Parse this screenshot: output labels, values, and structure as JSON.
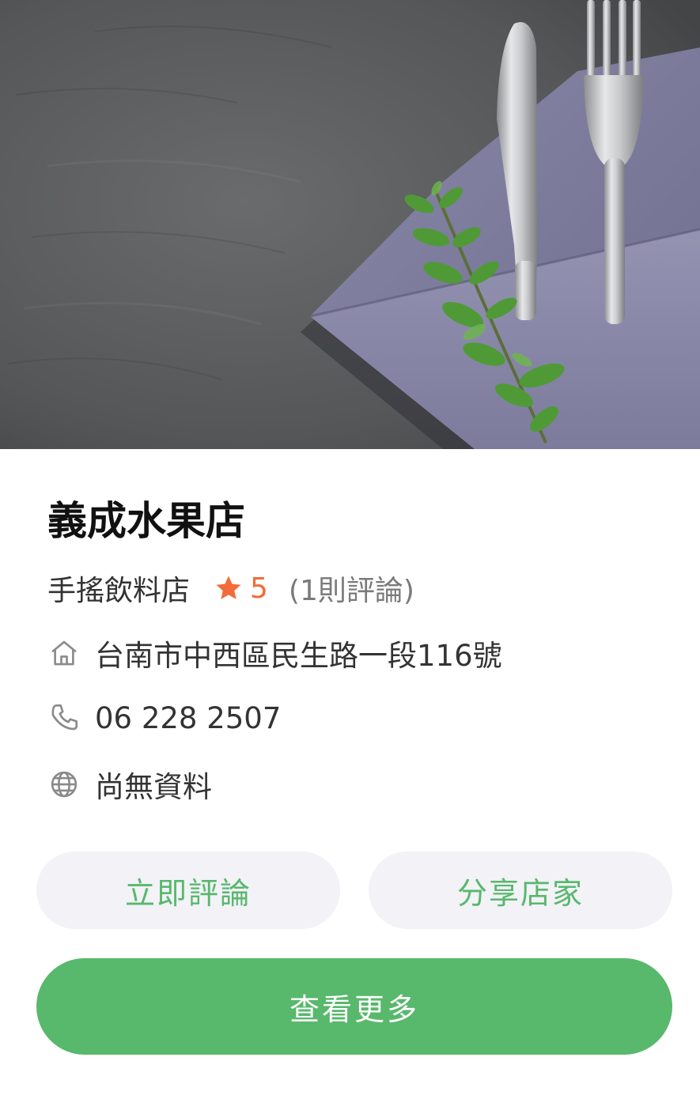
{
  "store": {
    "name": "義成水果店",
    "category": "手搖飲料店",
    "rating": "5",
    "review_count_text": "(1則評論)",
    "address": "台南市中西區民生路一段116號",
    "phone": "06 228 2507",
    "website": "尚無資料"
  },
  "hero": {
    "description_icon": "table-setting-photo"
  },
  "icons": {
    "star": "star-icon",
    "address": "home-icon",
    "phone": "phone-icon",
    "website": "globe-icon"
  },
  "actions": {
    "review_label": "立即評論",
    "share_label": "分享店家",
    "more_label": "查看更多"
  },
  "colors": {
    "accent_green": "#58b86c",
    "rating_orange": "#f26b3a",
    "button_light_bg": "#f2f2f7"
  }
}
